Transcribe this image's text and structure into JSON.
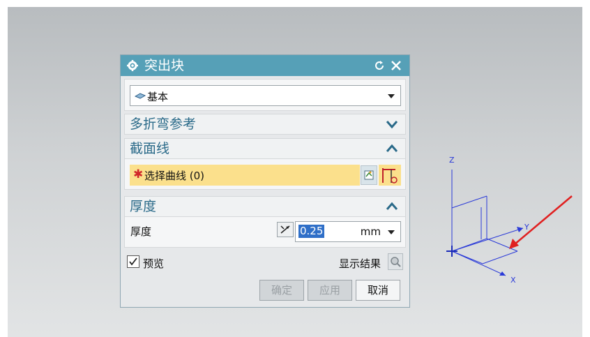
{
  "dialog": {
    "title": "突出块",
    "type_select": {
      "value": "基本"
    },
    "groups": {
      "multi_bend": {
        "label": "多折弯参考"
      },
      "section": {
        "label": "截面线",
        "select_curve_label": "选择曲线 (0)"
      },
      "thickness": {
        "label": "厚度",
        "field_label": "厚度",
        "value": "0.25",
        "unit": "mm"
      }
    },
    "preview": {
      "label": "预览",
      "checked": true,
      "show_result_label": "显示结果"
    },
    "buttons": {
      "ok": "确定",
      "apply": "应用",
      "cancel": "取消"
    }
  },
  "axes": {
    "z": "Z",
    "y": "Y",
    "x": "X"
  },
  "colors": {
    "title_bar": "#56a0b7",
    "highlight": "#fbe08c",
    "axis": "#2a3ad8",
    "arrow": "#e02020"
  }
}
